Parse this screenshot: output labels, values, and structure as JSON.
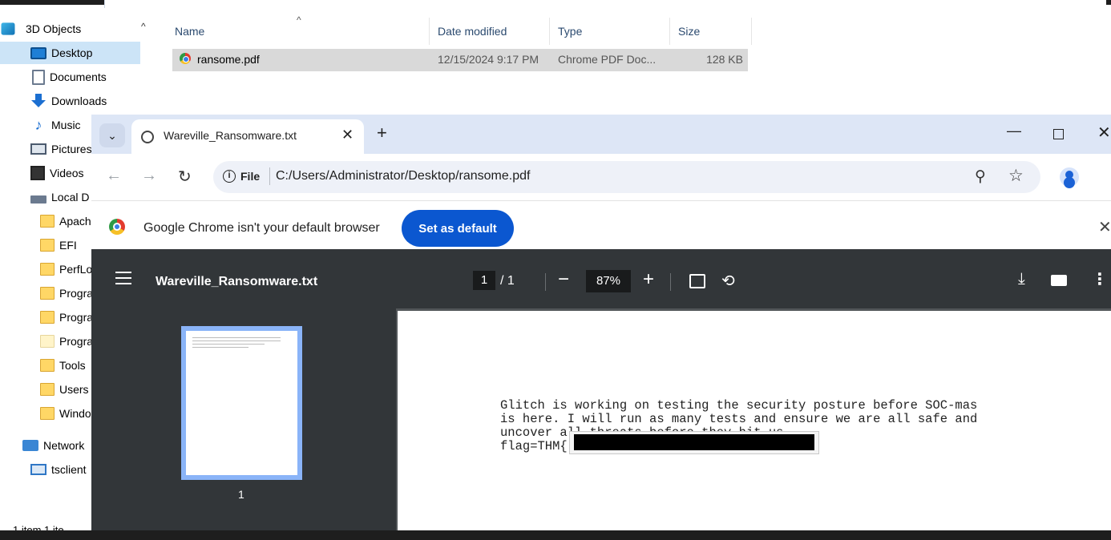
{
  "explorer": {
    "nav": [
      {
        "label": "3D Objects",
        "icon": "3d-objects-icon"
      },
      {
        "label": "Desktop",
        "icon": "desktop-icon",
        "selected": true
      },
      {
        "label": "Documents",
        "icon": "documents-icon"
      },
      {
        "label": "Downloads",
        "icon": "downloads-icon"
      },
      {
        "label": "Music",
        "icon": "music-icon"
      },
      {
        "label": "Pictures",
        "icon": "pictures-icon"
      },
      {
        "label": "Videos",
        "icon": "videos-icon"
      },
      {
        "label": "Local D",
        "icon": "local-disk-icon"
      },
      {
        "label": "Apach",
        "icon": "folder-icon"
      },
      {
        "label": "EFI",
        "icon": "folder-icon"
      },
      {
        "label": "PerfLo",
        "icon": "folder-icon"
      },
      {
        "label": "Progra",
        "icon": "folder-icon"
      },
      {
        "label": "Progra",
        "icon": "folder-icon"
      },
      {
        "label": "Progra",
        "icon": "folder-icon"
      },
      {
        "label": "Tools",
        "icon": "folder-icon"
      },
      {
        "label": "Users",
        "icon": "folder-icon"
      },
      {
        "label": "Windo",
        "icon": "folder-icon"
      },
      {
        "label": "Network",
        "icon": "network-icon"
      },
      {
        "label": "tsclient",
        "icon": "tsclient-icon"
      }
    ],
    "columns": {
      "name": "Name",
      "date": "Date modified",
      "type": "Type",
      "size": "Size"
    },
    "file": {
      "name": "ransome.pdf",
      "date": "12/15/2024 9:17 PM",
      "type": "Chrome PDF Doc...",
      "size": "128 KB"
    },
    "status": "1 item    1 ite"
  },
  "chrome": {
    "tab_title": "Wareville_Ransomware.txt",
    "omnibox": {
      "scheme_label": "File",
      "url": "C:/Users/Administrator/Desktop/ransome.pdf"
    },
    "infobar": {
      "message": "Google Chrome isn't your default browser",
      "button": "Set as default"
    },
    "pdf": {
      "title": "Wareville_Ransomware.txt",
      "current_page": "1",
      "page_total": "/  1",
      "zoom": "87%",
      "thumb_label": "1",
      "body_lines": [
        "Glitch is working on testing the security posture before SOC-mas",
        "is here. I will run as many tests and ensure we are all safe and",
        "uncover all threats before they hit us.",
        "flag=THM{"
      ]
    }
  },
  "colors": {
    "accent": "#0b57d0",
    "pdf_toolbar": "#323639",
    "thumb_border": "#8ab4f8",
    "selection": "#cce4f7"
  }
}
